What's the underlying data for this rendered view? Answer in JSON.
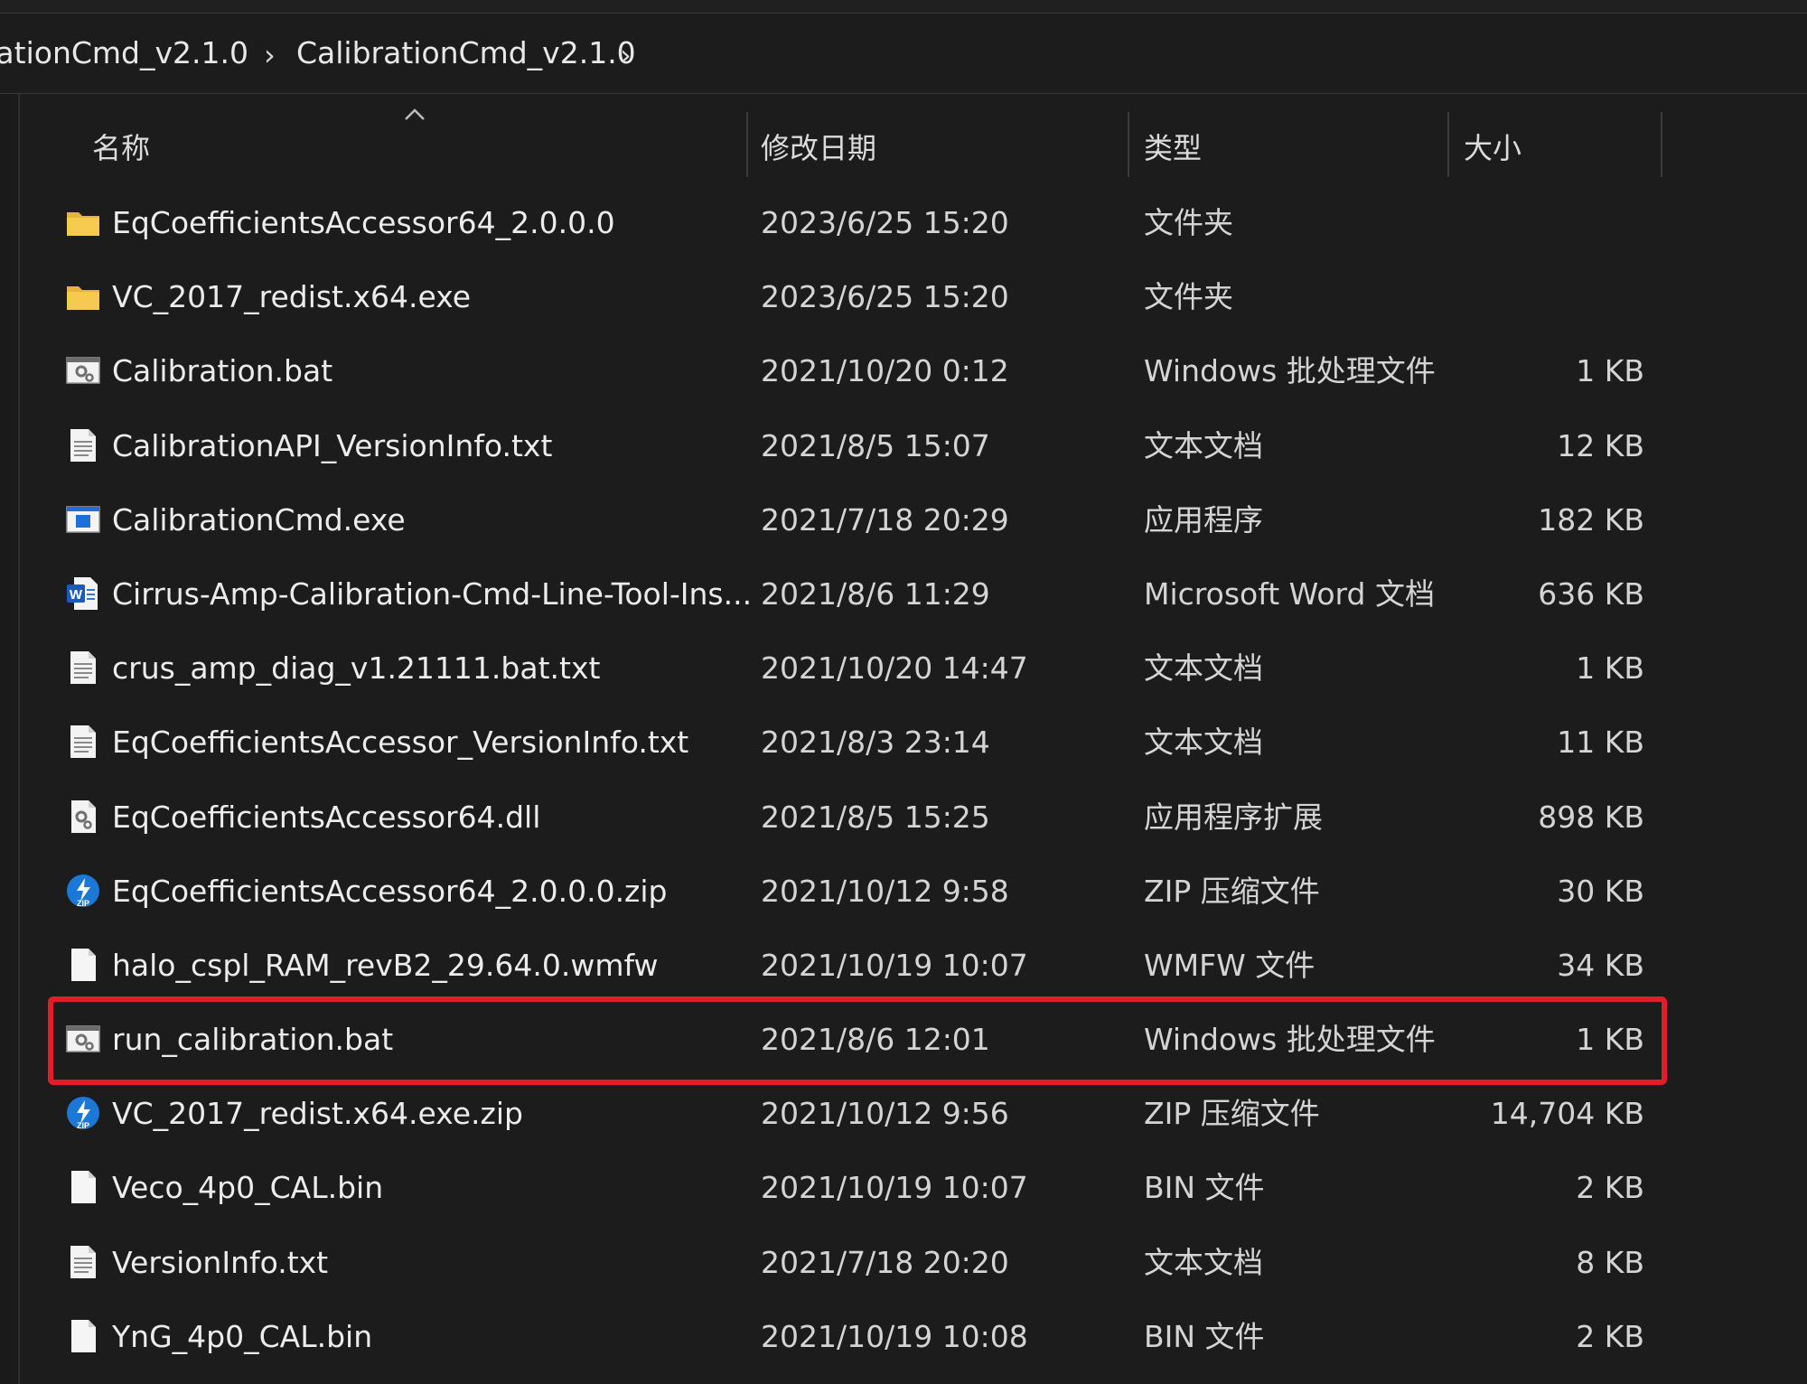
{
  "breadcrumb": {
    "items": [
      "rationCmd_v2.1.0",
      "CalibrationCmd_v2.1.0"
    ],
    "separator": "›"
  },
  "columns": {
    "name": "名称",
    "date": "修改日期",
    "type": "类型",
    "size": "大小"
  },
  "colors": {
    "background": "#1c1c1c",
    "highlight": "#e11d2a",
    "folder": "#f0c04a"
  },
  "files": [
    {
      "name": "EqCoefficientsAccessor64_2.0.0.0",
      "date": "2023/6/25 15:20",
      "type": "文件夹",
      "size": "",
      "icon": "folder-icon"
    },
    {
      "name": "VC_2017_redist.x64.exe",
      "date": "2023/6/25 15:20",
      "type": "文件夹",
      "size": "",
      "icon": "folder-icon"
    },
    {
      "name": "Calibration.bat",
      "date": "2021/10/20 0:12",
      "type": "Windows 批处理文件",
      "size": "1 KB",
      "icon": "batch-file-icon"
    },
    {
      "name": "CalibrationAPI_VersionInfo.txt",
      "date": "2021/8/5 15:07",
      "type": "文本文档",
      "size": "12 KB",
      "icon": "text-file-icon"
    },
    {
      "name": "CalibrationCmd.exe",
      "date": "2021/7/18 20:29",
      "type": "应用程序",
      "size": "182 KB",
      "icon": "application-icon"
    },
    {
      "name": "Cirrus-Amp-Calibration-Cmd-Line-Tool-Ins...",
      "date": "2021/8/6 11:29",
      "type": "Microsoft Word 文档",
      "size": "636 KB",
      "icon": "word-document-icon"
    },
    {
      "name": "crus_amp_diag_v1.21111.bat.txt",
      "date": "2021/10/20 14:47",
      "type": "文本文档",
      "size": "1 KB",
      "icon": "text-file-icon"
    },
    {
      "name": "EqCoefficientsAccessor_VersionInfo.txt",
      "date": "2021/8/3 23:14",
      "type": "文本文档",
      "size": "11 KB",
      "icon": "text-file-icon"
    },
    {
      "name": "EqCoefficientsAccessor64.dll",
      "date": "2021/8/5 15:25",
      "type": "应用程序扩展",
      "size": "898 KB",
      "icon": "dll-file-icon"
    },
    {
      "name": "EqCoefficientsAccessor64_2.0.0.0.zip",
      "date": "2021/10/12 9:58",
      "type": "ZIP 压缩文件",
      "size": "30 KB",
      "icon": "zip-file-icon"
    },
    {
      "name": "halo_cspl_RAM_revB2_29.64.0.wmfw",
      "date": "2021/10/19 10:07",
      "type": "WMFW 文件",
      "size": "34 KB",
      "icon": "blank-file-icon"
    },
    {
      "name": "run_calibration.bat",
      "date": "2021/8/6 12:01",
      "type": "Windows 批处理文件",
      "size": "1 KB",
      "icon": "batch-file-icon",
      "highlighted": true
    },
    {
      "name": "VC_2017_redist.x64.exe.zip",
      "date": "2021/10/12 9:56",
      "type": "ZIP 压缩文件",
      "size": "14,704 KB",
      "icon": "zip-file-icon"
    },
    {
      "name": "Veco_4p0_CAL.bin",
      "date": "2021/10/19 10:07",
      "type": "BIN 文件",
      "size": "2 KB",
      "icon": "blank-file-icon"
    },
    {
      "name": "VersionInfo.txt",
      "date": "2021/7/18 20:20",
      "type": "文本文档",
      "size": "8 KB",
      "icon": "text-file-icon"
    },
    {
      "name": "YnG_4p0_CAL.bin",
      "date": "2021/10/19 10:08",
      "type": "BIN 文件",
      "size": "2 KB",
      "icon": "blank-file-icon"
    }
  ]
}
